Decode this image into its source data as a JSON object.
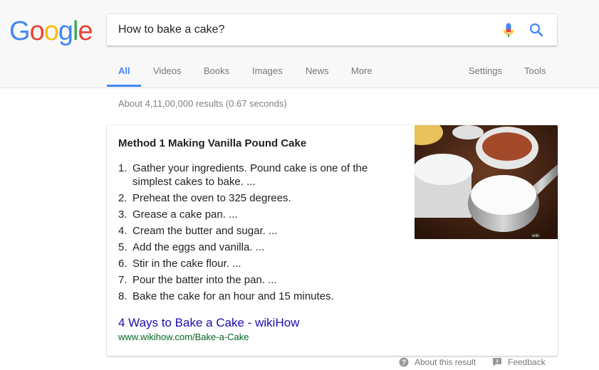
{
  "logo": {
    "letters": [
      "G",
      "o",
      "o",
      "g",
      "l",
      "e"
    ],
    "colors": [
      "#4285f4",
      "#ea4335",
      "#fbbc05",
      "#4285f4",
      "#34a853",
      "#ea4335"
    ]
  },
  "search": {
    "value": "How to bake a cake?",
    "mic_icon": "mic-icon",
    "search_icon": "search-icon"
  },
  "tabs": {
    "all": "All",
    "videos": "Videos",
    "books": "Books",
    "images": "Images",
    "news": "News",
    "more": "More",
    "settings": "Settings",
    "tools": "Tools"
  },
  "stats": "About 4,11,00,000 results (0.67 seconds)",
  "featured": {
    "title": "Method 1 Making Vanilla Pound Cake",
    "steps": [
      {
        "num": "1.",
        "text": "Gather your ingredients. Pound cake is one of the simplest cakes to bake. ..."
      },
      {
        "num": "2.",
        "text": "Preheat the oven to 325 degrees."
      },
      {
        "num": "3.",
        "text": "Grease a cake pan. ..."
      },
      {
        "num": "4.",
        "text": "Cream the butter and sugar. ..."
      },
      {
        "num": "5.",
        "text": "Add the eggs and vanilla. ..."
      },
      {
        "num": "6.",
        "text": "Stir in the cake flour. ..."
      },
      {
        "num": "7.",
        "text": "Pour the batter into the pan. ..."
      },
      {
        "num": "8.",
        "text": "Bake the cake for an hour and 15 minutes."
      }
    ],
    "link_text": "4 Ways to Bake a Cake - wikiHow",
    "url": "www.wikihow.com/Bake-a-Cake",
    "image_watermark": "wiki"
  },
  "footer": {
    "about": "About this result",
    "feedback": "Feedback"
  },
  "colors": {
    "accent": "#4285f4",
    "link": "#1a0dab",
    "url": "#006621",
    "muted": "#777777"
  }
}
